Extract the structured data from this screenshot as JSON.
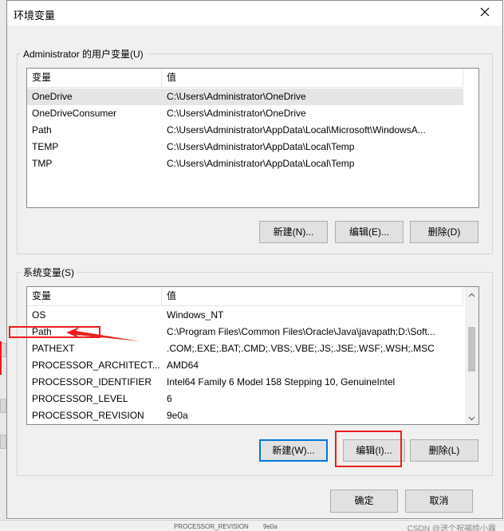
{
  "dialog": {
    "title": "环境变量",
    "close_icon": "close-icon"
  },
  "user_vars": {
    "group_label": "Administrator 的用户变量(U)",
    "columns": [
      "变量",
      "值"
    ],
    "rows": [
      {
        "name": "OneDrive",
        "value": "C:\\Users\\Administrator\\OneDrive"
      },
      {
        "name": "OneDriveConsumer",
        "value": "C:\\Users\\Administrator\\OneDrive"
      },
      {
        "name": "Path",
        "value": "C:\\Users\\Administrator\\AppData\\Local\\Microsoft\\WindowsA..."
      },
      {
        "name": "TEMP",
        "value": "C:\\Users\\Administrator\\AppData\\Local\\Temp"
      },
      {
        "name": "TMP",
        "value": "C:\\Users\\Administrator\\AppData\\Local\\Temp"
      }
    ],
    "buttons": {
      "new": "新建(N)...",
      "edit": "编辑(E)...",
      "delete": "删除(D)"
    }
  },
  "system_vars": {
    "group_label": "系统变量(S)",
    "columns": [
      "变量",
      "值"
    ],
    "rows": [
      {
        "name": "OS",
        "value": "Windows_NT"
      },
      {
        "name": "Path",
        "value": "C:\\Program Files\\Common Files\\Oracle\\Java\\javapath;D:\\Soft..."
      },
      {
        "name": "PATHEXT",
        "value": ".COM;.EXE;.BAT;.CMD;.VBS;.VBE;.JS;.JSE;.WSF;.WSH;.MSC"
      },
      {
        "name": "PROCESSOR_ARCHITECT...",
        "value": "AMD64"
      },
      {
        "name": "PROCESSOR_IDENTIFIER",
        "value": "Intel64 Family 6 Model 158 Stepping 10, GenuineIntel"
      },
      {
        "name": "PROCESSOR_LEVEL",
        "value": "6"
      },
      {
        "name": "PROCESSOR_REVISION",
        "value": "9e0a"
      }
    ],
    "buttons": {
      "new": "新建(W)...",
      "edit": "编辑(I)...",
      "delete": "删除(L)"
    }
  },
  "footer": {
    "ok": "确定",
    "cancel": "取消"
  },
  "background": {
    "row_name": "PROCESSOR_REVISION",
    "row_value": "9e0a",
    "watermark": "CSDN @送个祝福给小霖"
  },
  "annotation_color": "#ee1c1c"
}
